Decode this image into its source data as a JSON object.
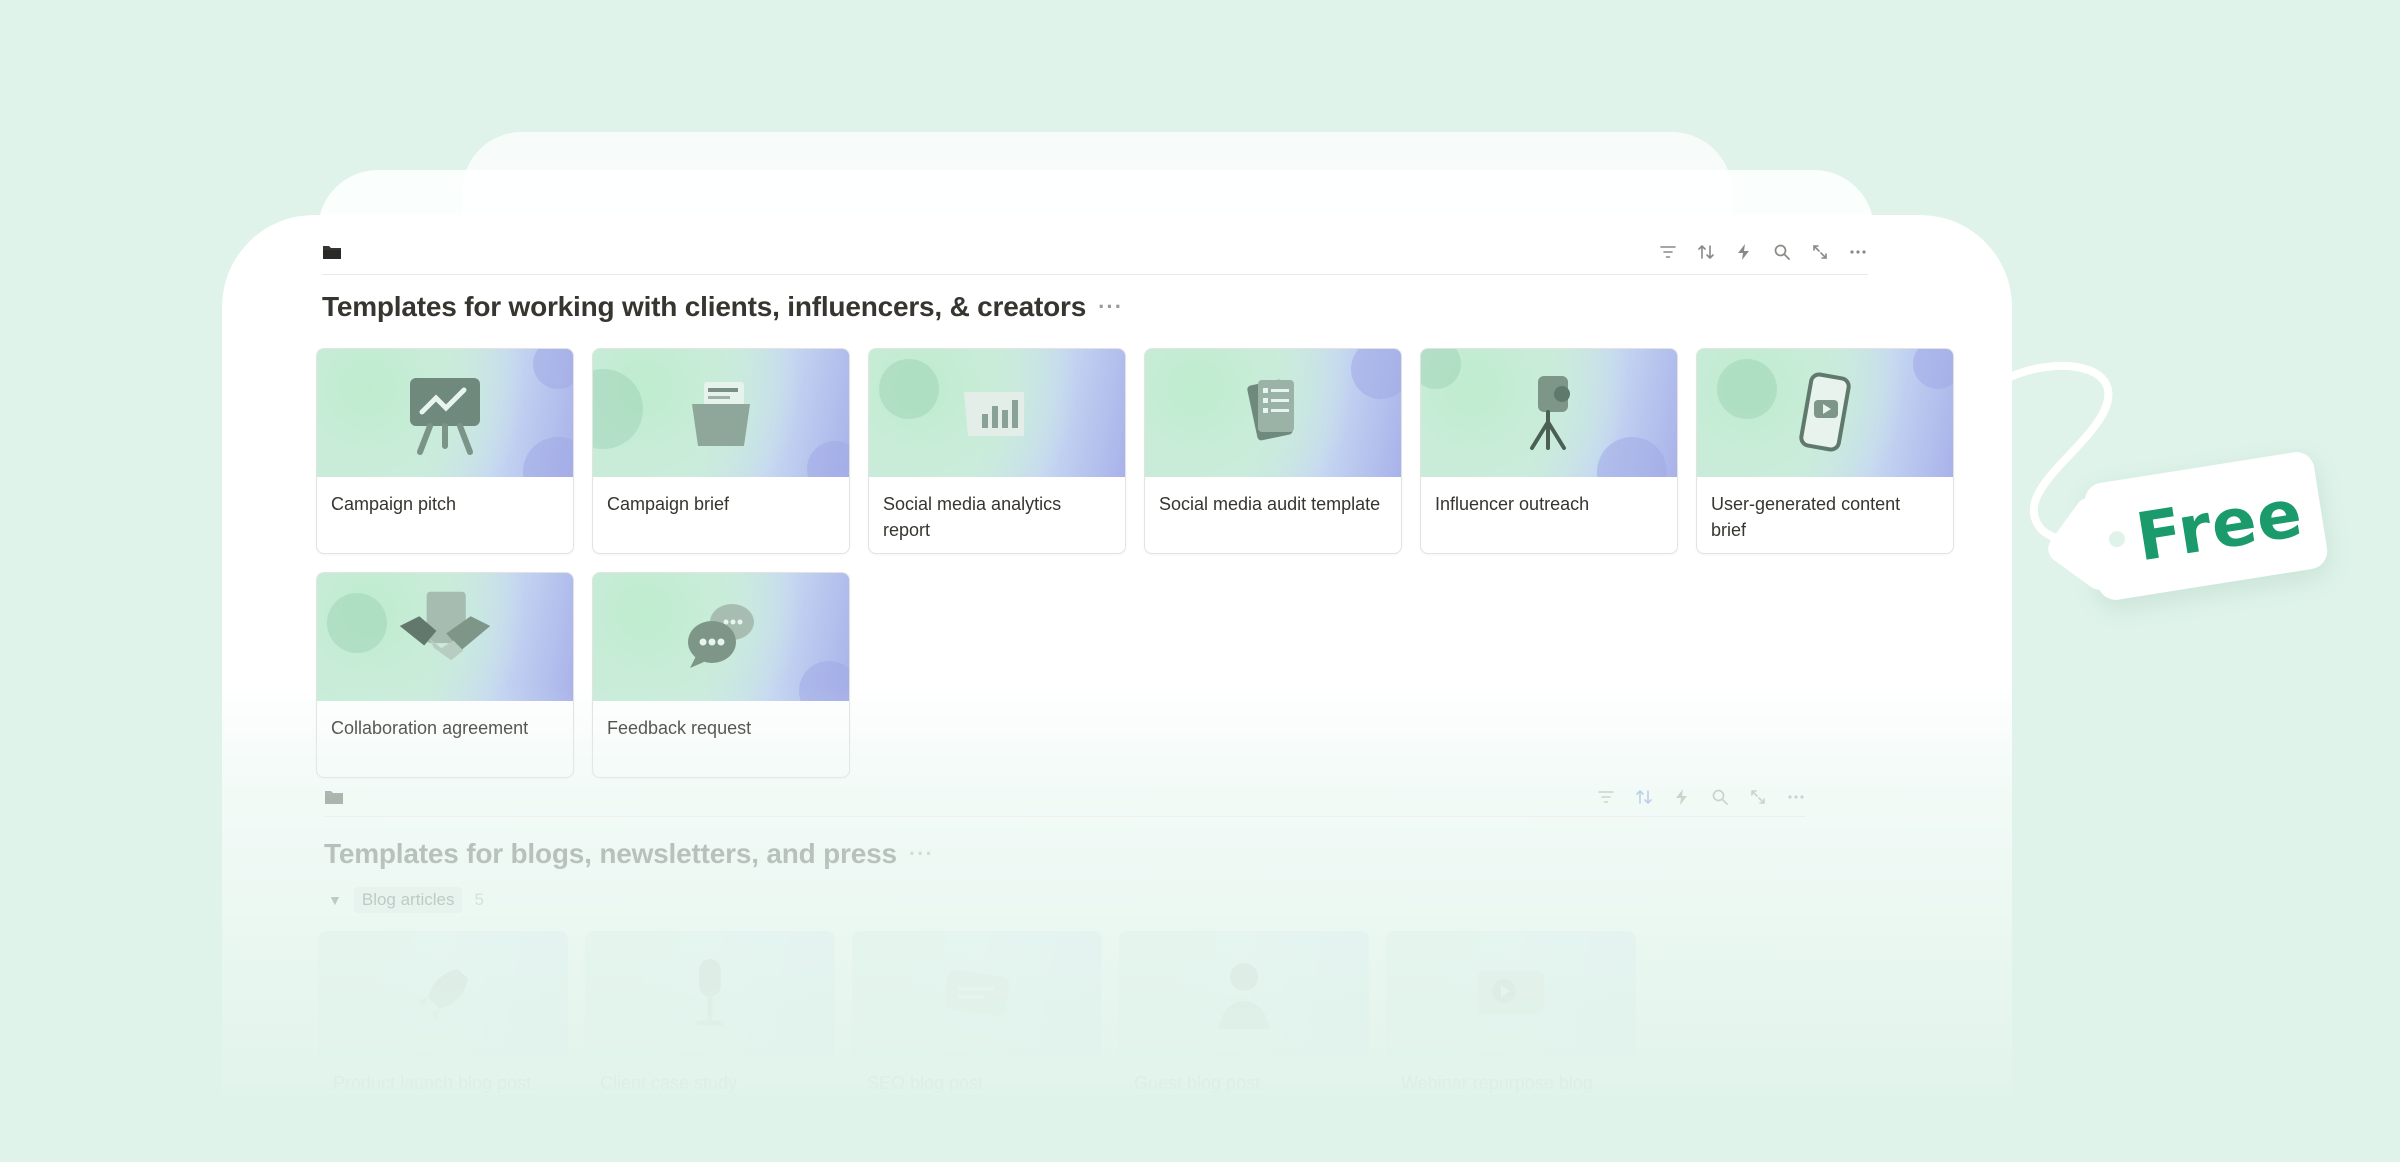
{
  "section1": {
    "title": "Templates for working with clients, influencers, & creators",
    "more": "···",
    "cards": [
      {
        "label": "Campaign pitch",
        "icon": "presentation-chart-icon"
      },
      {
        "label": "Campaign brief",
        "icon": "folder-documents-icon"
      },
      {
        "label": "Social media analytics report",
        "icon": "bar-chart-scroll-icon"
      },
      {
        "label": "Social media audit template",
        "icon": "checklist-icon"
      },
      {
        "label": "Influencer outreach",
        "icon": "camera-tripod-icon"
      },
      {
        "label": "User-generated content brief",
        "icon": "phone-play-icon"
      },
      {
        "label": "Collaboration agreement",
        "icon": "handshake-icon"
      },
      {
        "label": "Feedback request",
        "icon": "chat-bubbles-icon"
      }
    ]
  },
  "section2": {
    "title": "Templates for blogs, newsletters, and press",
    "more": "···",
    "group": {
      "caret": "▼",
      "label": "Blog articles",
      "count": "5"
    },
    "cards": [
      {
        "label": "Product launch blog post",
        "icon": "rocket-icon"
      },
      {
        "label": "Client case study",
        "icon": "microphone-icon"
      },
      {
        "label": "SEO blog post",
        "icon": "message-card-icon"
      },
      {
        "label": "Guest blog post",
        "icon": "person-icon"
      },
      {
        "label": "Webinar repurpose blog post",
        "icon": "video-player-icon"
      }
    ]
  },
  "tag": {
    "text": "Free"
  },
  "colors": {
    "accent": "#1b9a6c",
    "background": "#dff3ea",
    "sort_active": "#5a7fd6"
  }
}
